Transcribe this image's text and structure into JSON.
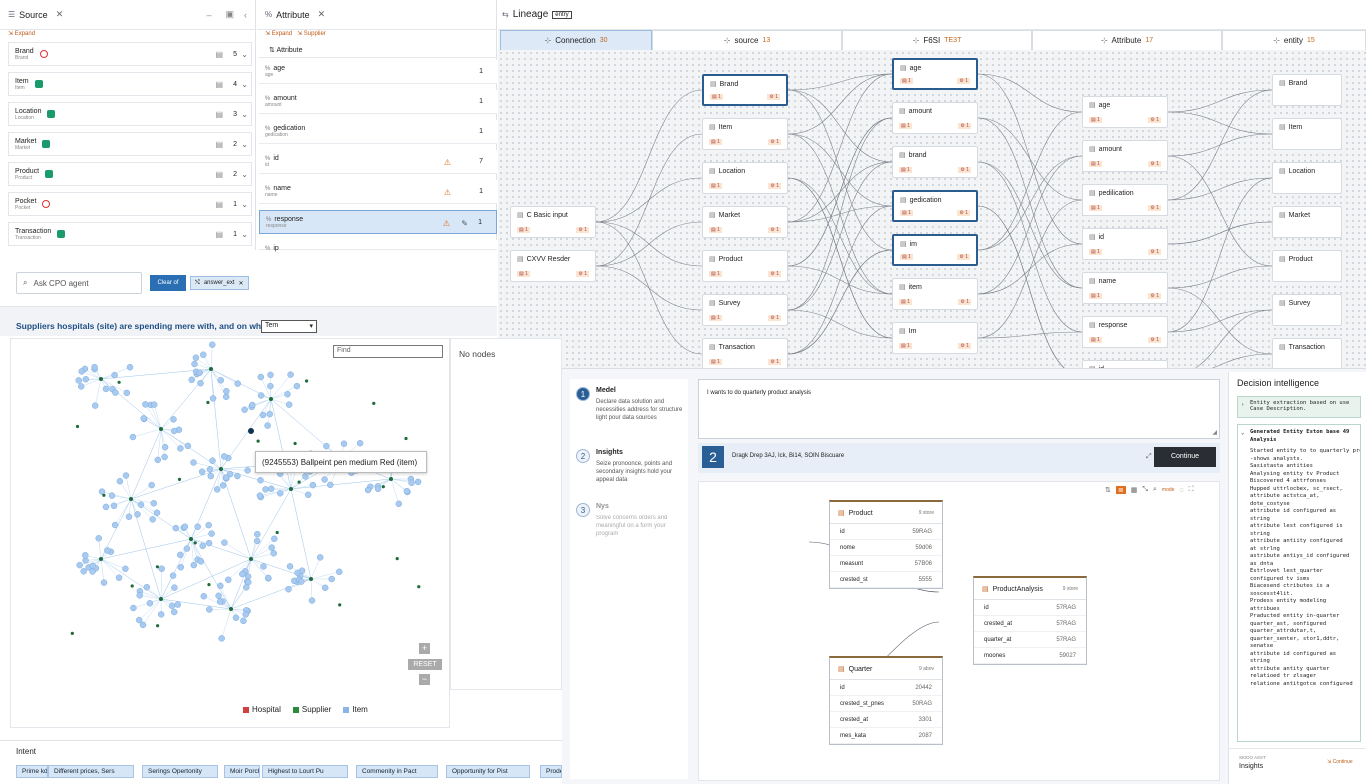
{
  "source_panel": {
    "title": "Source",
    "expand": "Expand",
    "rows": [
      {
        "name": "Brand",
        "sub": "Brand",
        "count": "5"
      },
      {
        "name": "Item",
        "sub": "Item",
        "count": "4"
      },
      {
        "name": "Location",
        "sub": "Location",
        "count": "3"
      },
      {
        "name": "Market",
        "sub": "Market",
        "count": "2"
      },
      {
        "name": "Product",
        "sub": "Product",
        "count": "2"
      },
      {
        "name": "Pocket",
        "sub": "Pocket",
        "count": "1"
      },
      {
        "name": "Transaction",
        "sub": "Transaction",
        "count": "1"
      }
    ]
  },
  "attr_panel": {
    "title": "Attribute",
    "expand": "Expand",
    "supplier": "Supplier",
    "column": "Attribute",
    "rows": [
      {
        "name": "age",
        "sub": "age",
        "count": "1"
      },
      {
        "name": "amount",
        "sub": "amount",
        "count": "1"
      },
      {
        "name": "gedication",
        "sub": "gedication",
        "count": "1"
      },
      {
        "name": "id",
        "sub": "id",
        "count": "7"
      },
      {
        "name": "name",
        "sub": "name",
        "count": "1"
      },
      {
        "name": "response",
        "sub": "response",
        "count": "1"
      },
      {
        "name": "ip",
        "sub": "",
        "count": ""
      }
    ]
  },
  "chat": {
    "search_placeholder": "Ask CPO agent",
    "clear_label": "Clear of",
    "filter_chip": "answer_ext",
    "question": "Suppliers hospitals (site) are spending mere with, and on what",
    "select_value": "Tem",
    "find_placeholder": "Find",
    "no_nodes": "No nodes",
    "tooltip": "(9245553) Ballpeint pen medium Red (item)",
    "reset": "RESET",
    "legend": [
      {
        "label": "Hospital",
        "color": "#d04040"
      },
      {
        "label": "Supplier",
        "color": "#2a8a3a"
      },
      {
        "label": "Item",
        "color": "#8ab4e8"
      }
    ]
  },
  "lineage": {
    "title": "Lineage",
    "badge": "entry",
    "columns": [
      {
        "label": "Connection",
        "count": "30"
      },
      {
        "label": "source",
        "count": "13"
      },
      {
        "label": "F6SI",
        "count": "TE3T"
      },
      {
        "label": "Attribute",
        "count": "17"
      },
      {
        "label": "entity",
        "count": "15"
      }
    ],
    "inputs": [
      "C Basic input",
      "CXVV Resder"
    ],
    "sources": [
      "Brand",
      "Item",
      "Location",
      "Market",
      "Product",
      "Survey",
      "Transaction"
    ],
    "fields": [
      "age",
      "amount",
      "brand",
      "gedication",
      "im",
      "item",
      "Im"
    ],
    "attributes": [
      "age",
      "amount",
      "pedilication",
      "id",
      "name",
      "response",
      "id"
    ],
    "entities": [
      "Brand",
      "Item",
      "Location",
      "Market",
      "Product",
      "Survey",
      "Transaction"
    ]
  },
  "wizard": {
    "steps": [
      {
        "n": "1",
        "title": "Medel",
        "text": "Declare data solution and necessities address for structure light pour data sources"
      },
      {
        "n": "2",
        "title": "Insights",
        "text": "Seize pronoonce, points and secondary insights hold your appeal data"
      },
      {
        "n": "3",
        "title": "Nys",
        "text": "Solve concerns orders and meaningful on a form your program"
      }
    ],
    "prompt": "I wants to do quarterly product analysis",
    "step_badge": "2",
    "attach_text": "Dragk Drep 3AJ, Ick, Bi14, SOIN Biscuare",
    "continue": "Continue",
    "toolbar_mode": "mode",
    "tables": [
      {
        "name": "Product",
        "tag": "9 store",
        "rows": [
          [
            "id",
            "59RAG"
          ],
          [
            "nome",
            "59d06"
          ],
          [
            "measunt",
            "57B06"
          ],
          [
            "crested_st",
            "5555"
          ]
        ]
      },
      {
        "name": "ProductAnalysis",
        "tag": "9 store",
        "rows": [
          [
            "id",
            "57RAG"
          ],
          [
            "crested_at",
            "57RAG"
          ],
          [
            "quarter_at",
            "57RAG"
          ],
          [
            "moones",
            "59027"
          ]
        ]
      },
      {
        "name": "Quarter",
        "tag": "9 abov",
        "rows": [
          [
            "id",
            "20442"
          ],
          [
            "crested_st_pnes",
            "50RAG"
          ],
          [
            "crested_at",
            "3301"
          ],
          [
            "mes_kata",
            "2087"
          ]
        ]
      }
    ]
  },
  "decision": {
    "title": "Decision intelligence",
    "collapsed": "Entity extraction based on use Case Description.",
    "section": "Generated Entity Eston base 49 Analysis",
    "lines": [
      "Started entity to to quarterly prodatt analysis.",
      "  -shows analysts.",
      "Sasistasta antities",
      "Analysing entity tv Product",
      "Biscovered 4 attrfonses",
      "Hupped uttrlocbex, sc_rsect,",
      "attribute actstca_at,",
      "dote_costyse",
      "attribute id configured as",
      "string",
      "attribute lest configured is",
      "string",
      "attribute antiity configured",
      "at strlng",
      "astribute antiys_id configured",
      "as dnta",
      "Estrlovet lest_quarter",
      "configured tv isms",
      "Biacesend ctributes is a",
      "soscesst4lit.",
      "Prodess entity modeling",
      "attribues",
      "Praducted entity in-quarter",
      "quarter_ast, sonfigured",
      "quarter_attrdutar,t,",
      "quarter_senter, stor1,ddtr,",
      "senatse",
      "attribute id configured as",
      "string",
      "attribute antity quarter",
      "relatioed tr zlsager",
      "relatione antitgotce configured"
    ],
    "footer_small": "SKIDO ASST",
    "footer": "Insights",
    "continue": "Continue"
  },
  "intent": {
    "title": "Intent",
    "chips": [
      "Prime kdation",
      "Different prices, Sers",
      "Serings Opertonity",
      "Moir Porcheses",
      "Highest to Lourt Pu",
      "Commenity in Pact",
      "Opportunity for Pist",
      "Prode Freed"
    ]
  }
}
